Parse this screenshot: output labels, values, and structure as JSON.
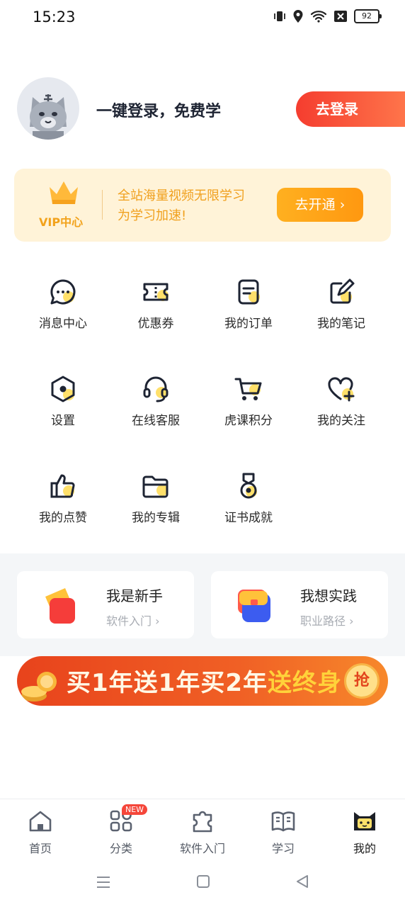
{
  "status_bar": {
    "time": "15:23",
    "battery": "92"
  },
  "header": {
    "login_prompt": "一键登录，免费学",
    "login_button": "去登录"
  },
  "vip": {
    "label": "VIP中心",
    "description": "全站海量视频无限学习 为学习加速!",
    "button": "去开通 ›"
  },
  "menu": [
    {
      "label": "消息中心",
      "icon": "message-icon"
    },
    {
      "label": "优惠券",
      "icon": "coupon-icon"
    },
    {
      "label": "我的订单",
      "icon": "order-icon"
    },
    {
      "label": "我的笔记",
      "icon": "note-icon"
    },
    {
      "label": "设置",
      "icon": "settings-icon"
    },
    {
      "label": "在线客服",
      "icon": "headset-icon"
    },
    {
      "label": "虎课积分",
      "icon": "cart-icon"
    },
    {
      "label": "我的关注",
      "icon": "heart-plus-icon"
    },
    {
      "label": "我的点赞",
      "icon": "thumbs-up-icon"
    },
    {
      "label": "我的专辑",
      "icon": "folder-icon"
    },
    {
      "label": "证书成就",
      "icon": "medal-icon"
    }
  ],
  "cards": [
    {
      "title": "我是新手",
      "subtitle": "软件入门 ›"
    },
    {
      "title": "我想实践",
      "subtitle": "职业路径 ›"
    }
  ],
  "banner": {
    "text_part1": "买1年送1年买2年",
    "text_part2": "送终身",
    "button": "抢"
  },
  "bottom_nav": [
    {
      "label": "首页",
      "icon": "home-icon"
    },
    {
      "label": "分类",
      "icon": "category-icon",
      "badge": "NEW"
    },
    {
      "label": "软件入门",
      "icon": "puzzle-icon"
    },
    {
      "label": "学习",
      "icon": "book-icon"
    },
    {
      "label": "我的",
      "icon": "cat-icon",
      "active": true
    }
  ],
  "colors": {
    "accent_red": "#f53d2f",
    "vip_gold": "#f2a21b",
    "icon_dark": "#1e2433",
    "icon_yellow": "#ffe06a"
  }
}
